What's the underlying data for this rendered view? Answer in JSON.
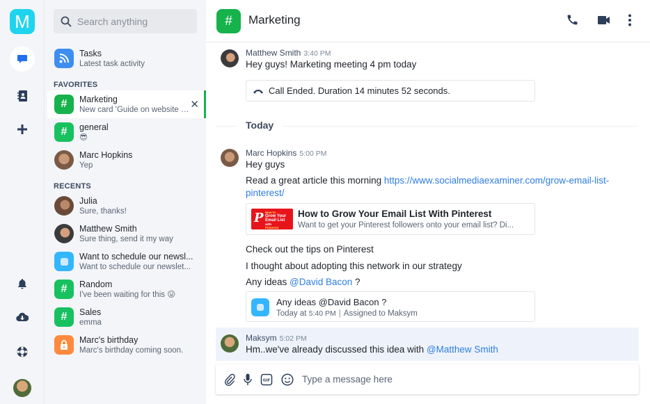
{
  "app": {
    "logo_letter": "M",
    "accent": "#16b24b",
    "logo_color": "#1fd4ee"
  },
  "rail": {
    "items": [
      {
        "name": "chat",
        "icon": "chat-bubble-icon",
        "active": true
      },
      {
        "name": "contacts",
        "icon": "address-book-icon"
      },
      {
        "name": "add",
        "icon": "plus-icon"
      },
      {
        "name": "notifications",
        "icon": "bell-icon"
      },
      {
        "name": "downloads",
        "icon": "cloud-download-icon"
      },
      {
        "name": "help",
        "icon": "lifebuoy-icon"
      }
    ]
  },
  "search": {
    "placeholder": "Search anything"
  },
  "list": {
    "tasks": {
      "title": "Tasks",
      "subtitle": "Latest task activity",
      "icon": "rss-icon"
    },
    "favorites_label": "FAVORITES",
    "favorites": [
      {
        "title": "Marketing",
        "subtitle": "New card 'Guide on website o...",
        "icon": "hash-icon",
        "active": true
      },
      {
        "title": "general",
        "subtitle": "😎",
        "icon": "hash-icon"
      },
      {
        "title": "Marc Hopkins",
        "subtitle": "Yep",
        "icon": "avatar"
      }
    ],
    "recents_label": "RECENTS",
    "recents": [
      {
        "title": "Julia",
        "subtitle": "Sure, thanks!",
        "icon": "avatar"
      },
      {
        "title": "Matthew Smith",
        "subtitle": "Sure thing, send it my way",
        "icon": "avatar"
      },
      {
        "title": "Want to schedule our newsl...",
        "subtitle": "Want to schedule our newslet...",
        "icon": "task-icon"
      },
      {
        "title": "Random",
        "subtitle": "I've been waiting for this 😛",
        "icon": "hash-icon"
      },
      {
        "title": "Sales",
        "subtitle": "emma",
        "icon": "hash-icon"
      },
      {
        "title": "Marc's birthday",
        "subtitle": "Marc's birthday coming soon.",
        "icon": "lock-icon"
      }
    ]
  },
  "chat": {
    "title": "Marketing",
    "header_actions": [
      "phone-icon",
      "video-icon",
      "more-vertical-icon"
    ],
    "messages": [
      {
        "author": "Matthew Smith",
        "time": "3:40 PM",
        "text": "Hey guys! Marketing meeting 4 pm today",
        "call_card": "Call Ended. Duration 14 minutes 52 seconds."
      }
    ],
    "day_divider": "Today",
    "marc": {
      "author": "Marc Hopkins",
      "time": "5:00 PM",
      "line1": "Hey guys",
      "line2_prefix": "Read a great article this morning ",
      "link_part1": "https://www.socialmediaexaminer.com/grow-email-list-",
      "link_part2": "pinterest/",
      "preview": {
        "title": "How to Grow Your Email List With Pinterest",
        "description": "Want to get your Pinterest followers onto your email list? Di...",
        "thumb_lines": [
          "How to",
          "Grow Your",
          "Email List",
          "with",
          "Pinterest"
        ]
      },
      "line3": "Check out the tips on Pinterest",
      "line4": "I thought about adopting this network in our strategy",
      "line5_prefix": "Any ideas ",
      "line5_mention": "@David Bacon",
      "line5_suffix": " ?",
      "task_card": {
        "title": "Any ideas @David Bacon ?",
        "meta_prefix": "Today at ",
        "meta_time": "5:40 PM",
        "meta_assigned": "Assigned to Maksym"
      }
    },
    "maksym": {
      "author": "Maksym",
      "time": "5:02 PM",
      "text_prefix": "Hm..we've already discussed this idea with ",
      "mention": "@Matthew Smith"
    },
    "composer": {
      "placeholder": "Type a message here",
      "tools": [
        "paperclip-icon",
        "microphone-icon",
        "gif-icon",
        "emoji-icon"
      ]
    }
  }
}
